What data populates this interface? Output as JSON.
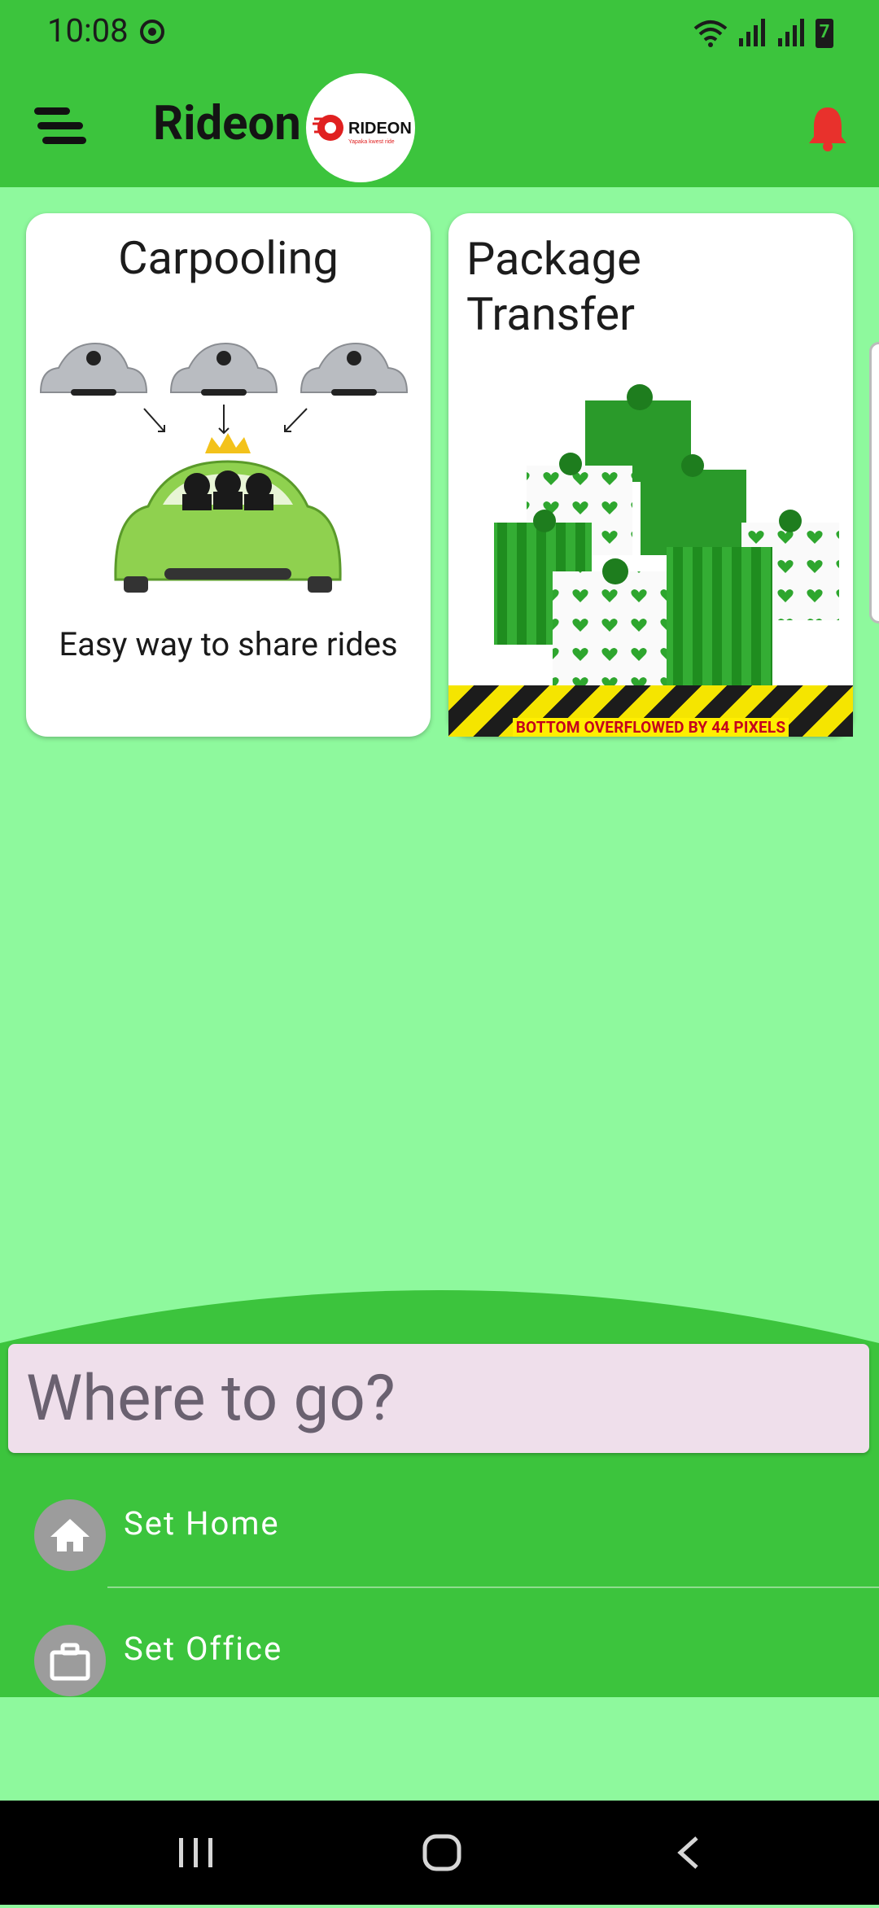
{
  "status": {
    "time": "10:08",
    "battery": "7"
  },
  "appbar": {
    "title": "Rideon",
    "logo_text": "RIDEON",
    "logo_tagline": "Yapaka kwest ride"
  },
  "cards": [
    {
      "title": "Carpooling",
      "caption": "Easy way to share rides"
    },
    {
      "title": "Package\nTransfer",
      "overflow_text": "BOTTOM OVERFLOWED BY 44 PIXELS"
    }
  ],
  "search": {
    "placeholder": "Where to go?"
  },
  "places": [
    {
      "label": "Set Home",
      "icon": "home-icon"
    },
    {
      "label": "Set Office",
      "icon": "briefcase-icon"
    }
  ],
  "colors": {
    "primary": "#3cc43d",
    "background": "#8ef99d",
    "bell": "#e8312c"
  }
}
